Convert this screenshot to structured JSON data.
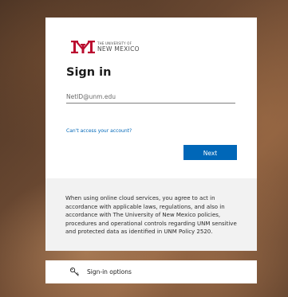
{
  "logo": {
    "line1": "THE UNIVERSITY OF",
    "line2": "NEW MEXICO",
    "color": "#ba0c2f"
  },
  "signin": {
    "title": "Sign in",
    "username_placeholder": "NetID@unm.edu",
    "cant_access_link": "Can't access your account?",
    "next_button": "Next"
  },
  "disclaimer": {
    "text": "When using online cloud services, you agree to act in accordance with applicable laws, regulations, and also in accordance with The University of New Mexico policies, procedures and operational controls regarding UNM sensitive and protected data as identified in UNM Policy 2520."
  },
  "options": {
    "label": "Sign-in options",
    "icon": "key-icon"
  },
  "colors": {
    "accent": "#0067b8",
    "brand": "#ba0c2f"
  }
}
